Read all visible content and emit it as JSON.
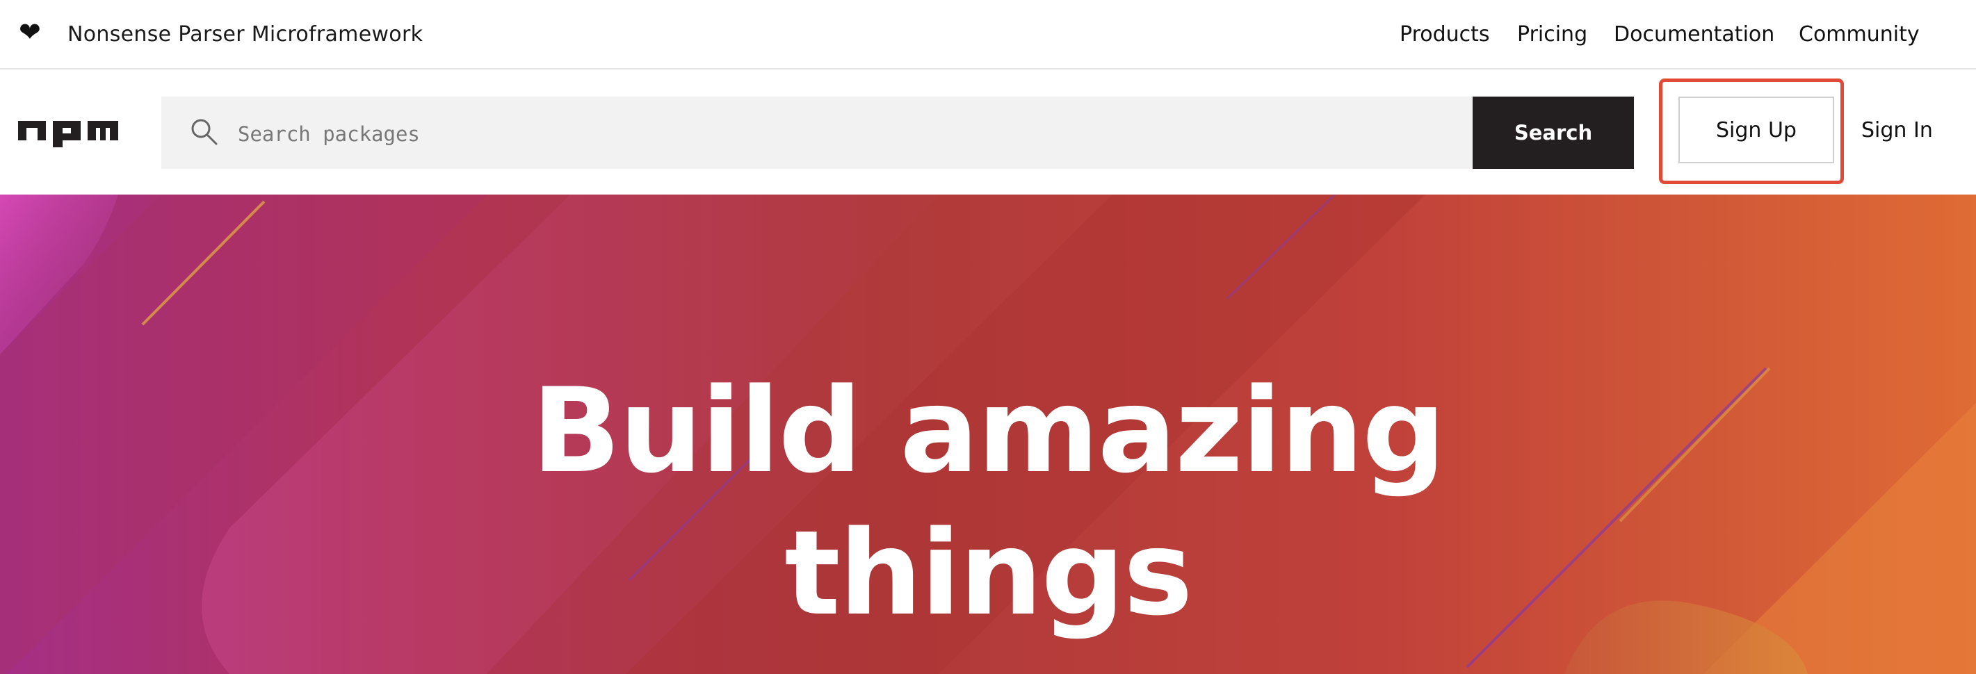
{
  "topbar": {
    "heart_glyph": "❤",
    "tagline": "Nonsense Parser Microframework",
    "nav": [
      {
        "label": "Products"
      },
      {
        "label": "Pricing"
      },
      {
        "label": "Documentation"
      },
      {
        "label": "Community"
      }
    ]
  },
  "header": {
    "logo_text": "npm",
    "search": {
      "placeholder": "Search packages",
      "value": "",
      "icon": "search-icon",
      "button_label": "Search"
    },
    "signup_label": "Sign Up",
    "signin_label": "Sign In",
    "highlight_color": "#e04a36"
  },
  "hero": {
    "title_line1": "Build amazing",
    "title_line2": "things"
  }
}
